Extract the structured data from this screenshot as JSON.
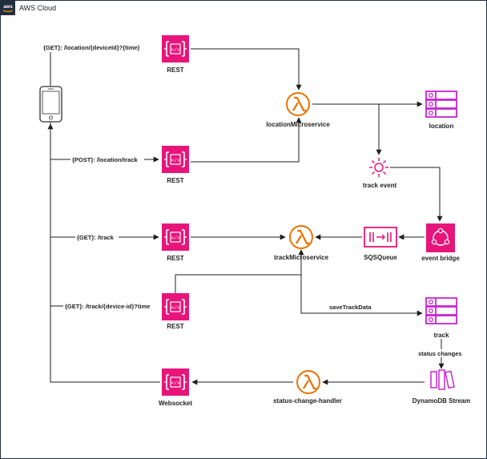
{
  "header": {
    "title": "AWS Cloud",
    "logo_text": "aws"
  },
  "colors": {
    "api": "#E7157B",
    "compute": "#ED7100",
    "storage": "#C925D1",
    "frame": "#232F3E",
    "line": "#1f1f1f"
  },
  "nodes": {
    "rest1": "REST",
    "rest2": "REST",
    "rest3": "REST",
    "rest4": "REST",
    "websocket": "Websocket",
    "location_ms": "locationMicroservice",
    "track_ms": "trackMicroservice",
    "status_handler": "status-change-handler",
    "location_db": "location",
    "track_db": "track",
    "track_event": "track event",
    "event_bridge": "event bridge",
    "sqs": "SQSQueue",
    "dynamo_stream": "DynamoDB Stream"
  },
  "edges": {
    "get_location": "{GET}: /location/{deviceId}?{time}",
    "post_location": "{POST}: /location/track",
    "get_track": "{GET}: /track",
    "get_track_id": "{GET}: /track/{device-id}?time",
    "save_track": "saveTrackData",
    "status_changes": "status changes"
  },
  "icons": {
    "client": "mobile-phone-icon",
    "api": "api-gateway-icon",
    "lambda": "lambda-icon",
    "table": "dynamodb-table-icon",
    "event": "event-icon",
    "bus": "eventbridge-icon",
    "queue": "sqs-queue-icon",
    "stream": "dynamodb-stream-icon"
  }
}
